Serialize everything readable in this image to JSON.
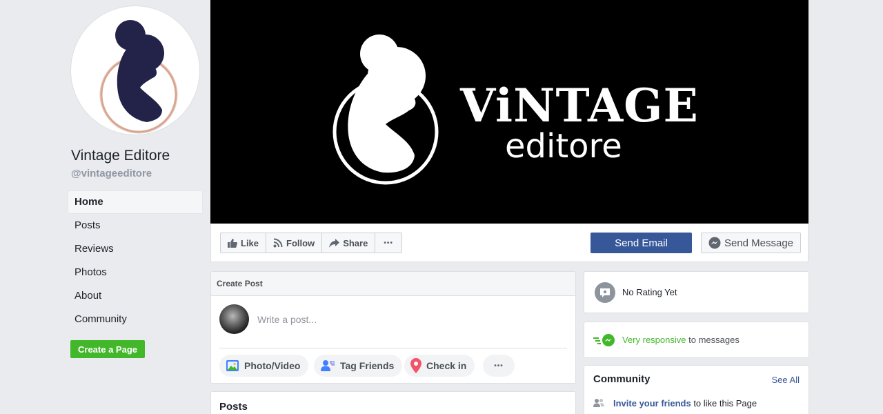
{
  "page": {
    "name": "Vintage Editore",
    "handle": "@vintageeditore"
  },
  "nav": {
    "items": [
      {
        "label": "Home",
        "active": true
      },
      {
        "label": "Posts"
      },
      {
        "label": "Reviews"
      },
      {
        "label": "Photos"
      },
      {
        "label": "About"
      },
      {
        "label": "Community"
      }
    ],
    "create_page": "Create a Page"
  },
  "cover": {
    "title": "ViNTAGE",
    "subtitle": "editore"
  },
  "actions": {
    "like": "Like",
    "follow": "Follow",
    "share": "Share",
    "more": "•••",
    "send_email": "Send Email",
    "send_message": "Send Message"
  },
  "create_post": {
    "header": "Create Post",
    "placeholder": "Write a post...",
    "photo_video": "Photo/Video",
    "tag_friends": "Tag Friends",
    "check_in": "Check in",
    "more": "•••"
  },
  "posts": {
    "title": "Posts"
  },
  "rating": {
    "text": "No Rating Yet"
  },
  "responsiveness": {
    "highlight": "Very responsive",
    "rest": " to messages"
  },
  "community": {
    "title": "Community",
    "see_all": "See All",
    "invite_link": "Invite your friends",
    "invite_rest": " to like this Page"
  },
  "colors": {
    "brand_blue": "#365899",
    "green": "#42b72a",
    "logo_navy": "#23234a",
    "logo_copper": "#d7a692"
  },
  "icons": {
    "like": "thumbs-up-icon",
    "follow": "rss-icon",
    "share": "share-arrow-icon",
    "messenger": "messenger-icon",
    "photo": "photo-icon",
    "tag": "tag-friends-icon",
    "checkin": "location-pin-icon",
    "rating": "rating-bubble-icon",
    "responsive": "fast-messenger-icon",
    "invite": "people-icon"
  }
}
